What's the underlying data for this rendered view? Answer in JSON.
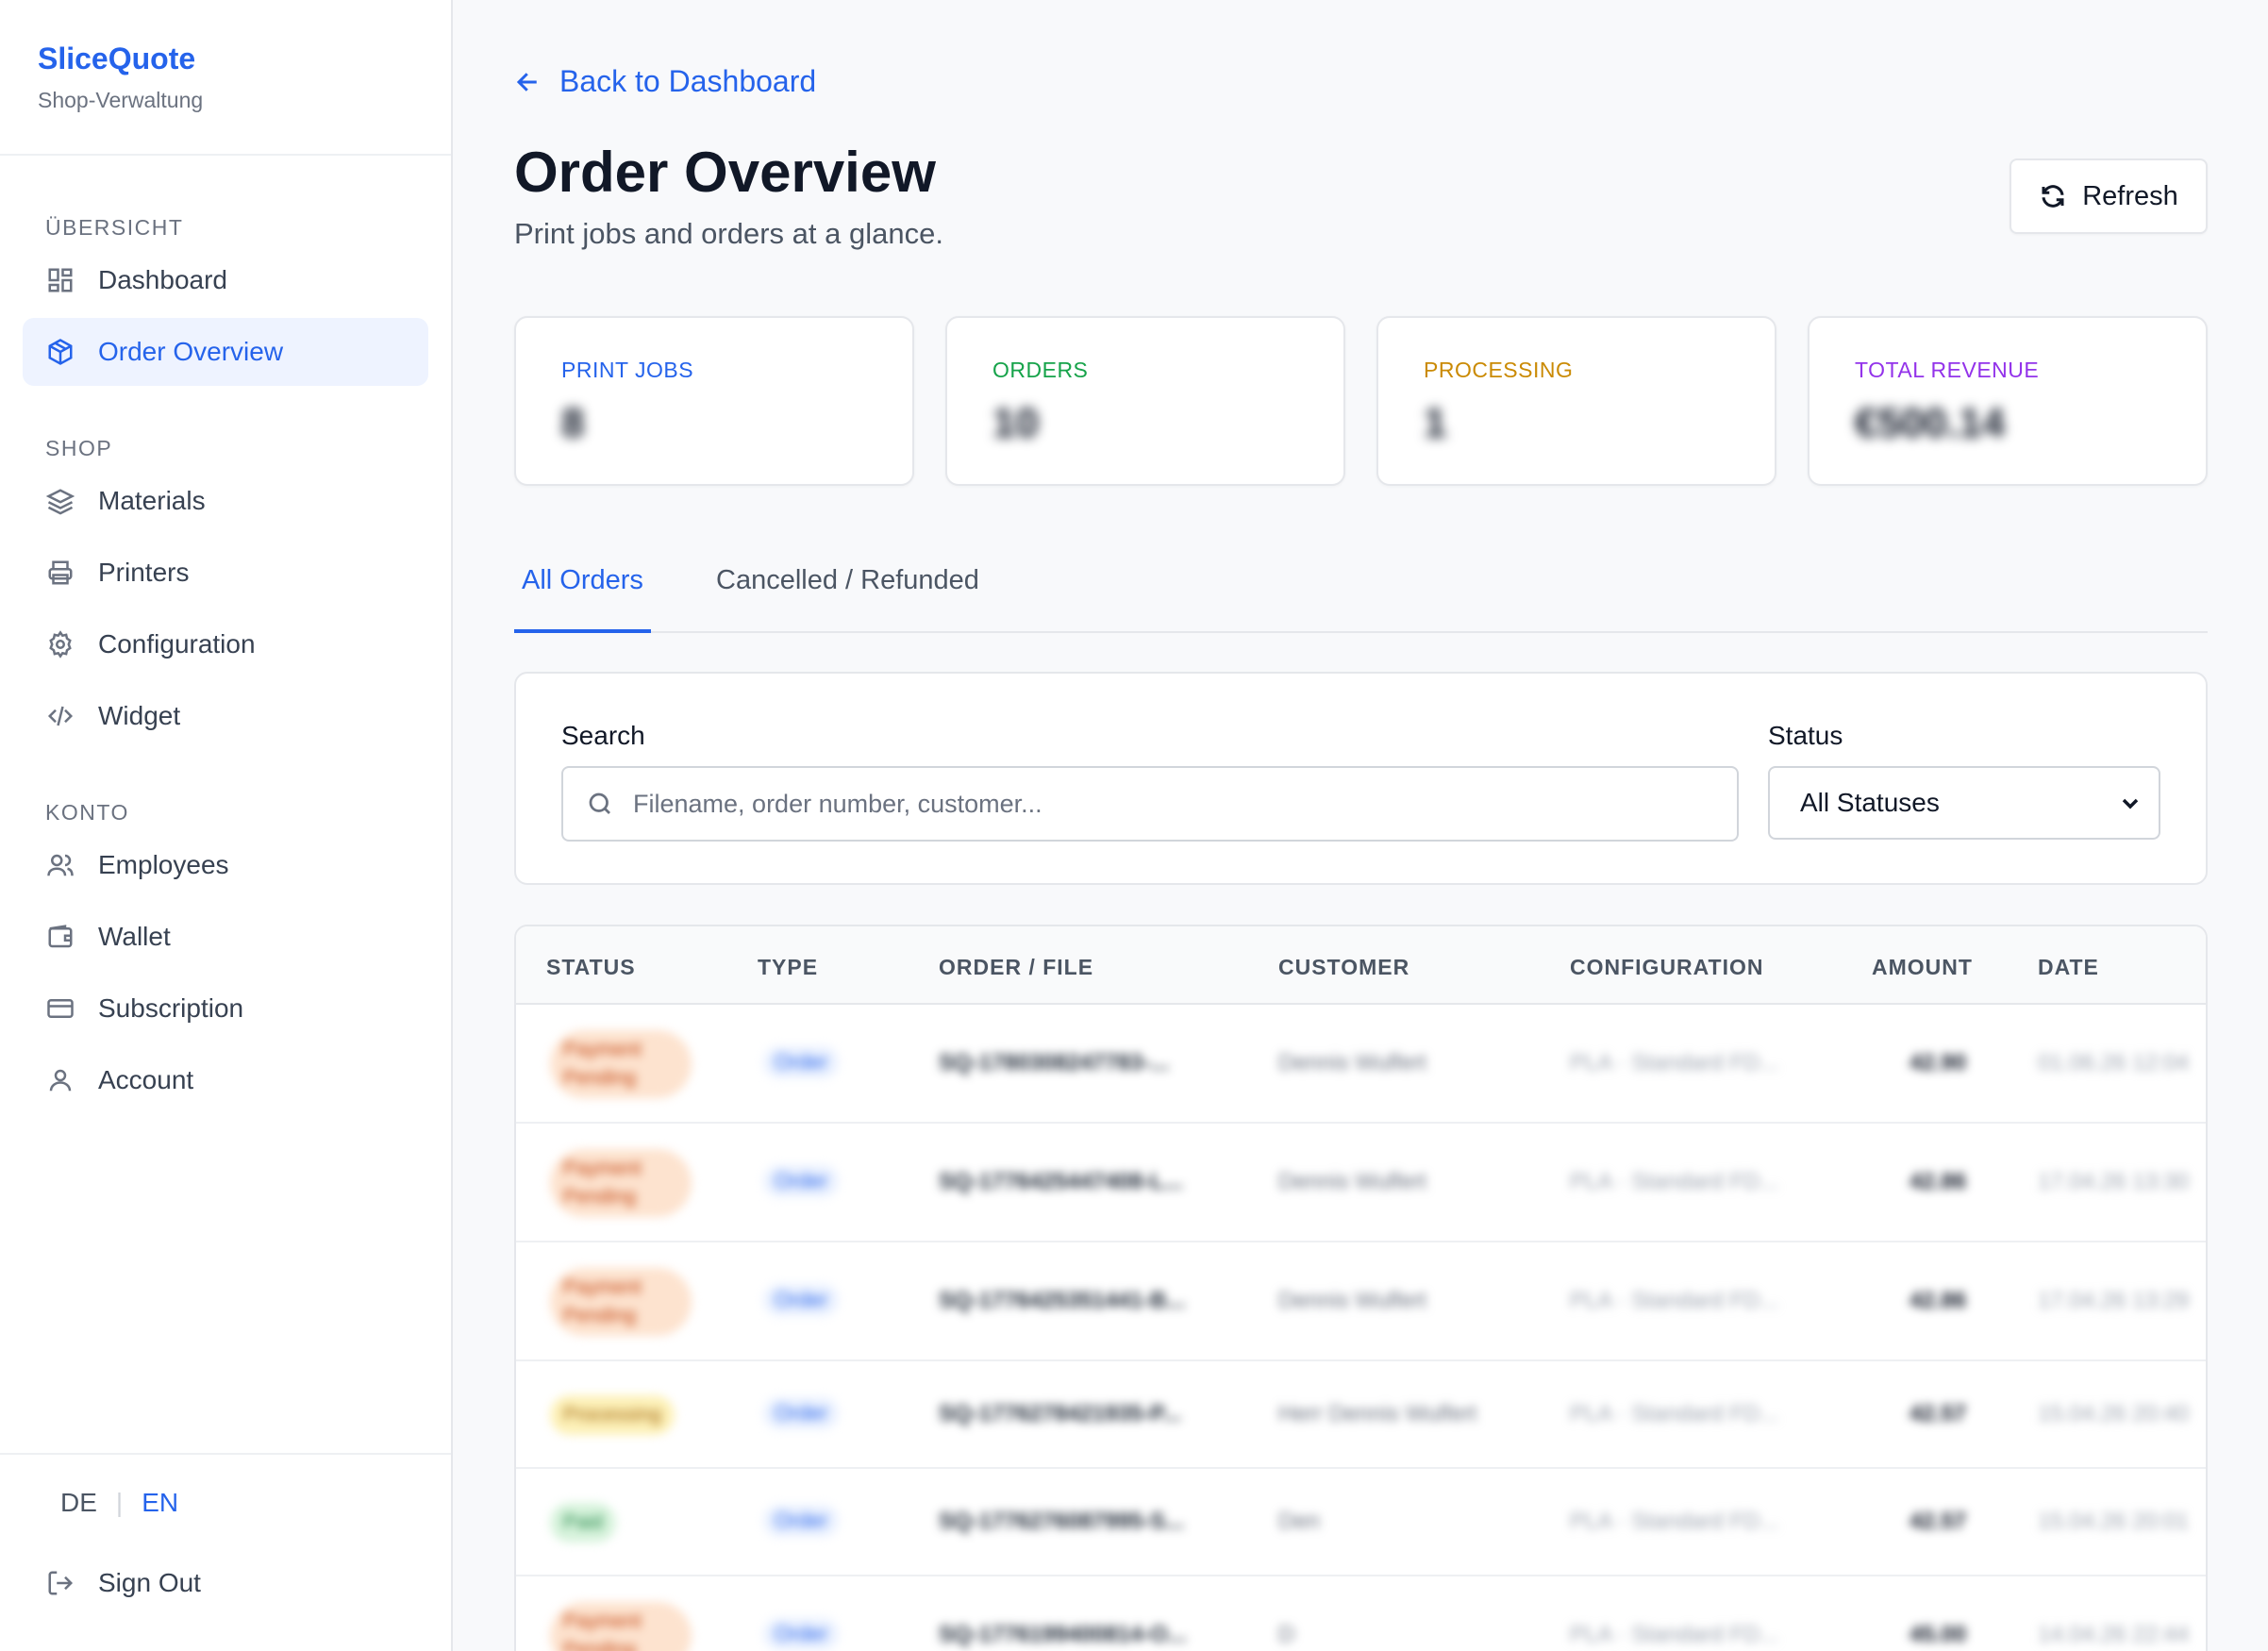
{
  "brand": {
    "name": "SliceQuote",
    "subtitle": "Shop-Verwaltung"
  },
  "sidebar": {
    "sections": [
      {
        "label": "ÜBERSICHT",
        "items": [
          {
            "label": "Dashboard",
            "icon": "dashboard-icon"
          },
          {
            "label": "Order Overview",
            "icon": "box-icon",
            "active": true
          }
        ]
      },
      {
        "label": "SHOP",
        "items": [
          {
            "label": "Materials",
            "icon": "layers-icon"
          },
          {
            "label": "Printers",
            "icon": "printer-icon"
          },
          {
            "label": "Configuration",
            "icon": "gear-icon"
          },
          {
            "label": "Widget",
            "icon": "code-icon"
          }
        ]
      },
      {
        "label": "KONTO",
        "items": [
          {
            "label": "Employees",
            "icon": "users-icon"
          },
          {
            "label": "Wallet",
            "icon": "wallet-icon"
          },
          {
            "label": "Subscription",
            "icon": "credit-card-icon"
          },
          {
            "label": "Account",
            "icon": "user-icon"
          }
        ]
      }
    ],
    "lang": {
      "de": "DE",
      "sep": "|",
      "en": "EN"
    },
    "signout": "Sign Out"
  },
  "header": {
    "back": "Back to Dashboard",
    "title": "Order Overview",
    "subtitle": "Print jobs and orders at a glance.",
    "refresh": "Refresh"
  },
  "stats": [
    {
      "label": "PRINT JOBS",
      "value": "8",
      "color": "#2563eb"
    },
    {
      "label": "ORDERS",
      "value": "10",
      "color": "#16a34a"
    },
    {
      "label": "PROCESSING",
      "value": "1",
      "color": "#ca8a04"
    },
    {
      "label": "TOTAL REVENUE",
      "value": "€500.14",
      "color": "#9333ea"
    }
  ],
  "tabs": {
    "all": "All Orders",
    "cancelled": "Cancelled / Refunded"
  },
  "filter": {
    "search_label": "Search",
    "search_placeholder": "Filename, order number, customer...",
    "status_label": "Status",
    "status_value": "All Statuses"
  },
  "table": {
    "headers": [
      "STATUS",
      "TYPE",
      "ORDER / FILE",
      "CUSTOMER",
      "CONFIGURATION",
      "AMOUNT",
      "DATE"
    ],
    "rows": [
      {
        "status": "Payment Pending",
        "status_kind": "pending",
        "type": "Order",
        "order": "SQ-1780308247783-...",
        "customer": "Dennis Wulfert",
        "config": "PLA · Standard FD...",
        "amount": "42.90",
        "date": "01.06.26 12:04"
      },
      {
        "status": "Payment Pending",
        "status_kind": "pending",
        "type": "Order",
        "order": "SQ-1776425447408-L...",
        "customer": "Dennis Wulfert",
        "config": "PLA · Standard FD...",
        "amount": "42.86",
        "date": "17.04.26 13:30"
      },
      {
        "status": "Payment Pending",
        "status_kind": "pending",
        "type": "Order",
        "order": "SQ-1776425351441-B...",
        "customer": "Dennis Wulfert",
        "config": "PLA · Standard FD...",
        "amount": "42.86",
        "date": "17.04.26 13:29"
      },
      {
        "status": "Processing",
        "status_kind": "processing",
        "type": "Order",
        "order": "SQ-1776278421935-P...",
        "customer": "Herr Dennis Wulfert",
        "config": "PLA · Standard FD...",
        "amount": "42.57",
        "date": "15.04.26 20:40"
      },
      {
        "status": "Paid",
        "status_kind": "paid",
        "type": "Order",
        "order": "SQ-1776276087995-S...",
        "customer": "Den",
        "config": "PLA · Standard FD...",
        "amount": "42.57",
        "date": "15.04.26 20:01"
      },
      {
        "status": "Payment Pending",
        "status_kind": "pending",
        "type": "Order",
        "order": "SQ-1776199400814-O...",
        "customer": "D",
        "config": "PLA · Standard FD...",
        "amount": "45.00",
        "date": "14.04.26 22:44"
      }
    ]
  },
  "colors": {
    "accent": "#2563eb",
    "pending_bg": "#fde3cf",
    "pending_fg": "#c2410c",
    "processing_bg": "#fdf1b8",
    "processing_fg": "#a16207",
    "paid_bg": "#d7f3dc",
    "paid_fg": "#15803d"
  }
}
